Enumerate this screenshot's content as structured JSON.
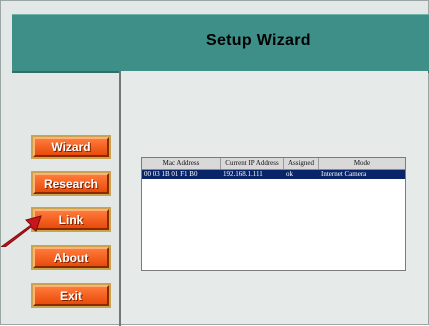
{
  "header": {
    "title": "Setup Wizard"
  },
  "sidebar": {
    "buttons": [
      {
        "label": "Wizard"
      },
      {
        "label": "Research"
      },
      {
        "label": "Link"
      },
      {
        "label": "About"
      },
      {
        "label": "Exit"
      }
    ]
  },
  "table": {
    "columns": [
      "Mac Address",
      "Current IP Address",
      "Assigned",
      "Mode"
    ],
    "rows": [
      {
        "mac": "00 03 1B 01 F1 B0",
        "ip": "192.168.1.111",
        "assigned": "ok",
        "mode": "Internet Camera"
      }
    ]
  },
  "colors": {
    "header_bg": "#3f8f89",
    "button_bg": "#e84b0c",
    "selection_bg": "#0a246a",
    "arrow": "#c8161b"
  }
}
